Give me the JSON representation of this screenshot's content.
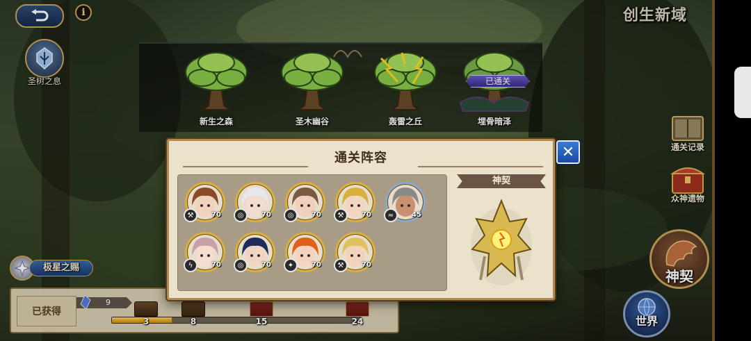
{
  "header": {
    "title": "创生新域",
    "back_icon": "back-arrow-icon",
    "info_label": "i"
  },
  "left_menu": {
    "holy_tree_label": "圣树之息",
    "polaris_gift_label": "极星之赐"
  },
  "trees": [
    {
      "name": "新生之森",
      "cleared": false,
      "variant": "green"
    },
    {
      "name": "圣木幽谷",
      "cleared": false,
      "variant": "green"
    },
    {
      "name": "轰雷之丘",
      "cleared": false,
      "variant": "lightning"
    },
    {
      "name": "埋骨暗泽",
      "cleared": true,
      "variant": "dark"
    }
  ],
  "cleared_badge": "已通关",
  "right_menu": {
    "clear_record_label": "通关记录",
    "gods_relic_label": "众神遗物",
    "contract_label": "神契",
    "world_label": "世界"
  },
  "progress": {
    "obtained_label": "已获得",
    "count": "9",
    "fraction": 0.24,
    "milestones": [
      {
        "value": "3",
        "type": "brown"
      },
      {
        "value": "8",
        "type": "brown"
      },
      {
        "value": "15",
        "type": "red"
      },
      {
        "value": "24",
        "type": "red"
      }
    ]
  },
  "modal": {
    "title": "通关阵容",
    "contract_section": "神契",
    "close_icon": "close-x-icon",
    "heroes": [
      {
        "level": "70",
        "element": "⚒",
        "hair": "#8a4a2a",
        "skin": "#f1d2bc",
        "ring": "#d9b040"
      },
      {
        "level": "70",
        "element": "◎",
        "hair": "#e8e8ea",
        "skin": "#f2dccf",
        "ring": "#d9b040"
      },
      {
        "level": "70",
        "element": "◎",
        "hair": "#7a5a40",
        "skin": "#f0d0bc",
        "ring": "#d9b040"
      },
      {
        "level": "70",
        "element": "⚒",
        "hair": "#d8b040",
        "skin": "#f3d6c0",
        "ring": "#d9b040"
      },
      {
        "level": "45",
        "element": "≈",
        "hair": "#8a8a8a",
        "skin": "#c89070",
        "ring": "#8aa8d0"
      },
      {
        "level": "70",
        "element": "ϟ",
        "hair": "#c8a0a8",
        "skin": "#f4dcd0",
        "ring": "#d9b040"
      },
      {
        "level": "70",
        "element": "◎",
        "hair": "#1e2a5a",
        "skin": "#f0d4c4",
        "ring": "#d9b040"
      },
      {
        "level": "70",
        "element": "✦",
        "hair": "#e0601a",
        "skin": "#f4d4c0",
        "ring": "#d9b040"
      },
      {
        "level": "70",
        "element": "⚒",
        "hair": "#e0c060",
        "skin": "#f2d4bc",
        "ring": "#d9b040"
      }
    ]
  }
}
